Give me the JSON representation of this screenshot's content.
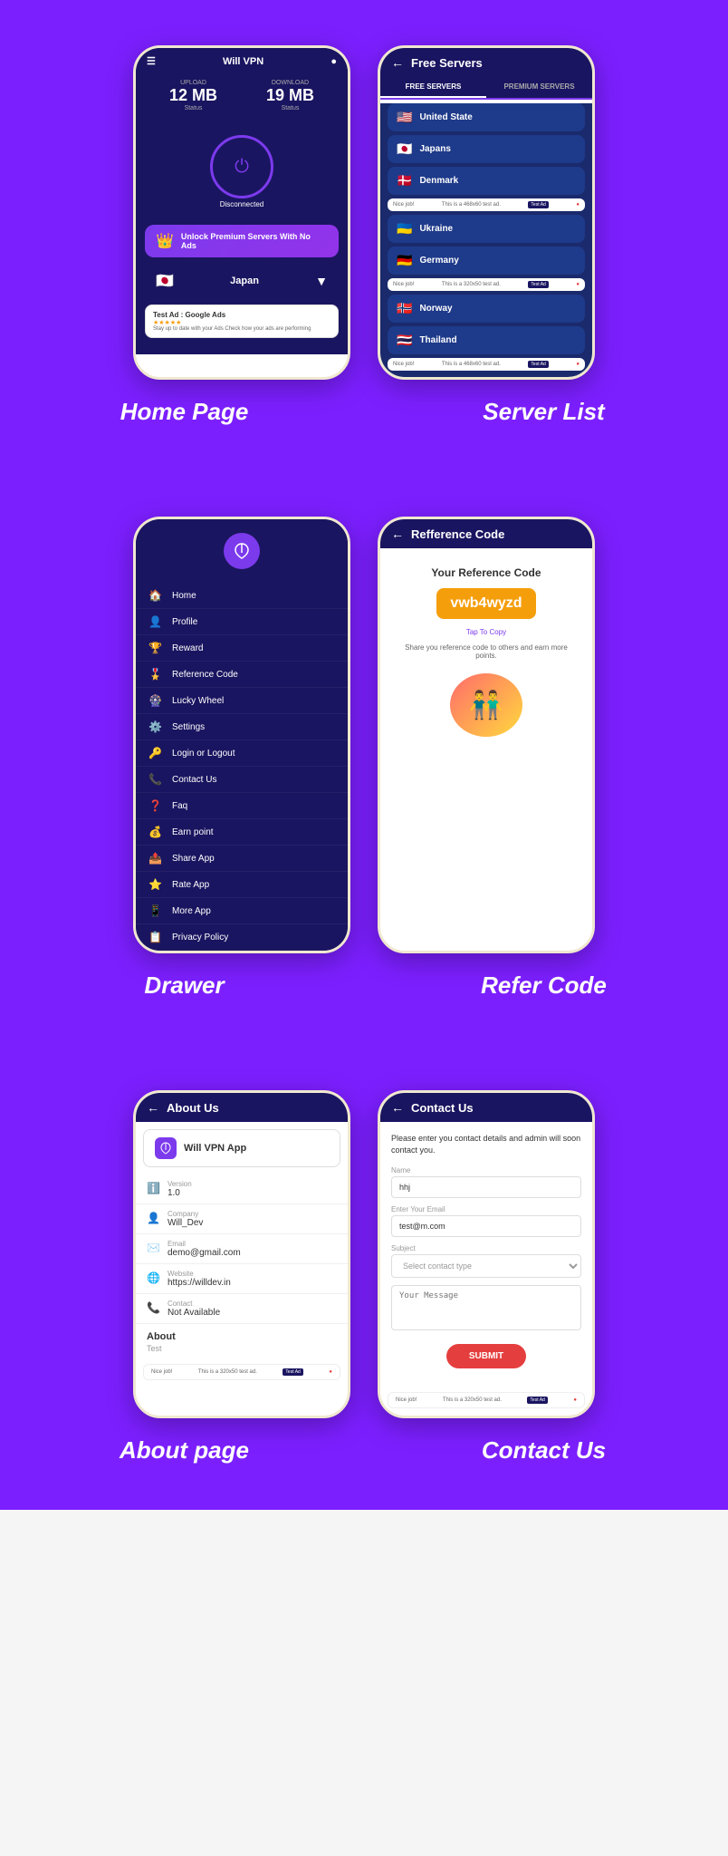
{
  "sections": [
    {
      "id": "section1",
      "phones": [
        {
          "id": "home",
          "label": "Home Page"
        },
        {
          "id": "serverlist",
          "label": "Server List"
        }
      ]
    },
    {
      "id": "section2",
      "phones": [
        {
          "id": "drawer",
          "label": "Drawer"
        },
        {
          "id": "refercode",
          "label": "Refer Code"
        }
      ]
    },
    {
      "id": "section3",
      "phones": [
        {
          "id": "about",
          "label": "About page"
        },
        {
          "id": "contact",
          "label": "Contact Us"
        }
      ]
    }
  ],
  "home": {
    "title": "Will VPN",
    "upload": {
      "label": "UPLOAD",
      "value": "12 MB",
      "status": "Status"
    },
    "download": {
      "label": "DOWNLOAD",
      "value": "19 MB",
      "status": "Status"
    },
    "status": "Disconnected",
    "premium": "Unlock Premium Servers With No Ads",
    "country": "Japan",
    "ad_title": "Test Ad : Google Ads",
    "ad_desc": "Stay up to date with your Ads Check how your ads are performing"
  },
  "serverlist": {
    "title": "Free Servers",
    "tab_free": "FREE SERVERS",
    "tab_premium": "PREMIUM SERVERS",
    "servers": [
      {
        "flag": "🇺🇸",
        "name": "United State"
      },
      {
        "flag": "🇯🇵",
        "name": "Japans"
      },
      {
        "flag": "🇩🇰",
        "name": "Denmark"
      },
      {
        "flag": "🇺🇦",
        "name": "Ukraine"
      },
      {
        "flag": "🇩🇪",
        "name": "Germany"
      },
      {
        "flag": "🇳🇴",
        "name": "Norway"
      },
      {
        "flag": "🇹🇭",
        "name": "Thailand"
      }
    ],
    "ad_text": "Nice job!",
    "ad_label": "Test Ad",
    "ad_sub": "This is a 468x60 test ad."
  },
  "drawer": {
    "logo": "VPN",
    "items": [
      {
        "icon": "🏠",
        "label": "Home"
      },
      {
        "icon": "👤",
        "label": "Profile"
      },
      {
        "icon": "🏆",
        "label": "Reward"
      },
      {
        "icon": "🎖️",
        "label": "Reference Code"
      },
      {
        "icon": "🎡",
        "label": "Lucky Wheel"
      },
      {
        "icon": "⚙️",
        "label": "Settings"
      },
      {
        "icon": "🔑",
        "label": "Login or Logout"
      },
      {
        "icon": "📞",
        "label": "Contact Us"
      },
      {
        "icon": "❓",
        "label": "Faq"
      },
      {
        "icon": "💰",
        "label": "Earn point"
      },
      {
        "icon": "📤",
        "label": "Share App"
      },
      {
        "icon": "⭐",
        "label": "Rate App"
      },
      {
        "icon": "📱",
        "label": "More App"
      },
      {
        "icon": "📋",
        "label": "Privacy Policy"
      }
    ]
  },
  "refercode": {
    "title": "Refference Code",
    "subtitle": "Your Reference Code",
    "code": "vwb4wyzd",
    "tap_label": "Tap To Copy",
    "desc": "Share you reference code to others and earn more points."
  },
  "about": {
    "title": "About Us",
    "app_name": "Will VPN App",
    "items": [
      {
        "icon": "ℹ️",
        "label": "Version",
        "value": "1.0"
      },
      {
        "icon": "👤",
        "label": "Company",
        "value": "Will_Dev"
      },
      {
        "icon": "✉️",
        "label": "Email",
        "value": "demo@gmail.com"
      },
      {
        "icon": "🌐",
        "label": "Website",
        "value": "https://willdev.in"
      },
      {
        "icon": "📞",
        "label": "Contact",
        "value": "Not Available"
      }
    ],
    "about_title": "About",
    "about_text": "Test",
    "ad_text": "Nice job!",
    "ad_label": "Test Ad",
    "ad_sub": "This is a 320x50 test ad."
  },
  "contact": {
    "title": "Contact Us",
    "desc": "Please enter you contact details and admin will soon contact you.",
    "name_label": "Name",
    "name_value": "hhj",
    "email_label": "Enter Your Email",
    "email_value": "test@m.com",
    "subject_label": "Subject",
    "subject_placeholder": "Select contact type",
    "message_placeholder": "Your Message",
    "submit_label": "SUBMIT",
    "ad_text": "Nice job!",
    "ad_label": "Test Ad",
    "ad_sub": "This is a 320x50 test ad."
  }
}
